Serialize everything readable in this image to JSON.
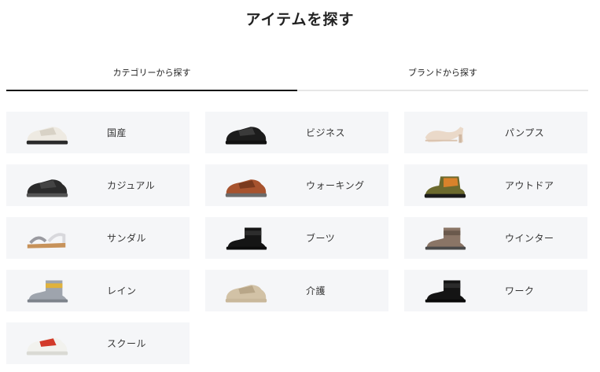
{
  "page": {
    "title": "アイテムを探す"
  },
  "tabs": [
    {
      "label": "カテゴリーから探す",
      "active": true
    },
    {
      "label": "ブランドから探す",
      "active": false
    }
  ],
  "categories": [
    {
      "label": "国産",
      "icon": "sneaker-white-icon",
      "colors": {
        "upper": "#eeeae2",
        "accent": "#d8d2c6",
        "sole": "#2a2a2a"
      }
    },
    {
      "label": "ビジネス",
      "icon": "business-shoe-icon",
      "colors": {
        "upper": "#1c1c1c",
        "accent": "#3a3a3a",
        "sole": "#111111"
      }
    },
    {
      "label": "パンプス",
      "icon": "pump-icon",
      "colors": {
        "upper": "#ead9c9",
        "accent": "#d9c2ad",
        "sole": "#cfb8a2"
      }
    },
    {
      "label": "カジュアル",
      "icon": "casual-sneaker-icon",
      "colors": {
        "upper": "#2b2b2b",
        "accent": "#444444",
        "sole": "#555555"
      }
    },
    {
      "label": "ウォーキング",
      "icon": "walking-shoe-icon",
      "colors": {
        "upper": "#a7532e",
        "accent": "#7a3a1e",
        "sole": "#6b6b6b"
      }
    },
    {
      "label": "アウトドア",
      "icon": "outdoor-boot-icon",
      "colors": {
        "upper": "#6c6a2e",
        "accent": "#d9822b",
        "sole": "#1a1a1a"
      }
    },
    {
      "label": "サンダル",
      "icon": "sandal-icon",
      "colors": {
        "upper": "#9a9aa0",
        "accent": "#d8d8dc",
        "sole": "#c7925a"
      }
    },
    {
      "label": "ブーツ",
      "icon": "boot-icon",
      "colors": {
        "upper": "#151515",
        "accent": "#2d2d2d",
        "sole": "#0c0c0c"
      }
    },
    {
      "label": "ウインター",
      "icon": "winter-boot-icon",
      "colors": {
        "upper": "#8a7566",
        "accent": "#6a594c",
        "sole": "#4a4a4a"
      }
    },
    {
      "label": "レイン",
      "icon": "rain-boot-icon",
      "colors": {
        "upper": "#9ea4ad",
        "accent": "#e0b23c",
        "sole": "#7d838b"
      }
    },
    {
      "label": "介護",
      "icon": "care-shoe-icon",
      "colors": {
        "upper": "#d2c2a6",
        "accent": "#b8a688",
        "sole": "#c9b89b"
      }
    },
    {
      "label": "ワーク",
      "icon": "work-boot-icon",
      "colors": {
        "upper": "#141414",
        "accent": "#2b2b2b",
        "sole": "#0a0a0a"
      }
    },
    {
      "label": "スクール",
      "icon": "school-shoe-icon",
      "colors": {
        "upper": "#f2f2ee",
        "accent": "#d23a2a",
        "sole": "#dadad4"
      }
    }
  ]
}
